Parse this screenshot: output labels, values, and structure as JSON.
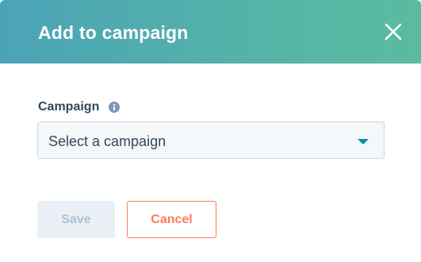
{
  "dialog": {
    "title": "Add to campaign",
    "close_icon": "close-icon"
  },
  "field": {
    "label": "Campaign",
    "info_icon": "info-icon",
    "select": {
      "selected_value": "Select a campaign",
      "caret_icon": "caret-down-icon"
    }
  },
  "actions": {
    "save_label": "Save",
    "save_disabled": true,
    "cancel_label": "Cancel"
  },
  "colors": {
    "header_gradient_start": "#4ba3b6",
    "header_gradient_end": "#5bbba0",
    "accent_orange": "#ff7a59",
    "caret_teal": "#0091ae",
    "label_text": "#33475b",
    "disabled_button_bg": "#eaf0f6",
    "disabled_button_text": "#b0c1d4"
  }
}
